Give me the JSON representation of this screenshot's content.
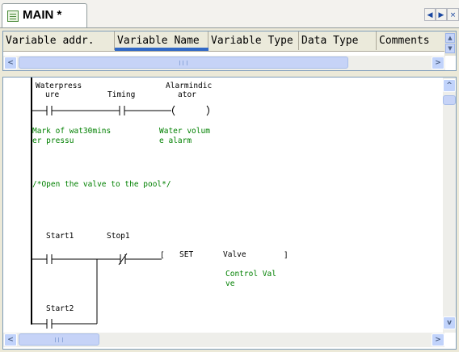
{
  "tab": {
    "title": "MAIN *"
  },
  "nav": {
    "prev": "◀",
    "next": "▶",
    "close": "×"
  },
  "var_table": {
    "columns": [
      "Variable addr.",
      "Variable Name",
      "Variable Type",
      "Data Type",
      "Comments"
    ]
  },
  "scroll": {
    "left": "<",
    "right": ">",
    "up": "^",
    "down": "v"
  },
  "ladder": {
    "rung1": {
      "contact1": {
        "name_line1": "Waterpress",
        "name_line2": "ure",
        "comment_line1": "Mark of wat30mins",
        "comment_line2": "er pressu"
      },
      "contact2": {
        "name": "Timing",
        "comment_line1": "Water volum",
        "comment_line2": "e alarm"
      },
      "coil": {
        "name_line1": "Alarmindic",
        "name_line2": "ator"
      }
    },
    "comment_text": "/*Open the valve to the pool*/",
    "rung2": {
      "contact1": {
        "name": "Start1"
      },
      "contact2": {
        "name": "Stop1"
      },
      "contact3": {
        "name": "Start2"
      },
      "instruction": {
        "op": "SET",
        "operand": "Valve",
        "bracket_open": "[",
        "bracket_close": "]",
        "comment_line1": "Control Val",
        "comment_line2": "ve"
      }
    }
  }
}
